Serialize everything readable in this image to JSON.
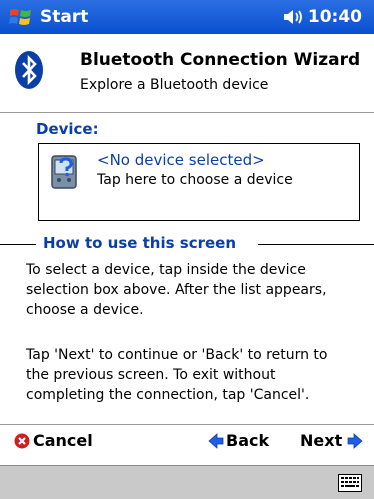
{
  "titlebar": {
    "start_label": "Start",
    "time": "10:40",
    "icons": [
      "windows-flag-icon",
      "volume-icon"
    ]
  },
  "header": {
    "title": "Bluetooth Connection Wizard",
    "subtitle": "Explore a Bluetooth device",
    "icon": "bluetooth-icon"
  },
  "device": {
    "label": "Device:",
    "selected": "<No device selected>",
    "hint": "Tap here to choose a device",
    "icon": "device-help-icon"
  },
  "howto": {
    "title": "How to use this screen",
    "paragraph1": [
      "To select a device, tap inside the device",
      "selection box above. After the list appears,",
      "choose a device."
    ],
    "paragraph2": [
      "Tap 'Next' to continue or 'Back' to return to",
      "the previous screen. To exit without",
      "completing the connection, tap 'Cancel'."
    ]
  },
  "commands": {
    "cancel": "Cancel",
    "back": "Back",
    "next": "Next"
  },
  "colors": {
    "titlebar": "#0a4fcf",
    "accent_text": "#0b3fa8",
    "cancel_red": "#d21e1e",
    "arrow_blue": "#1e5ee8"
  }
}
